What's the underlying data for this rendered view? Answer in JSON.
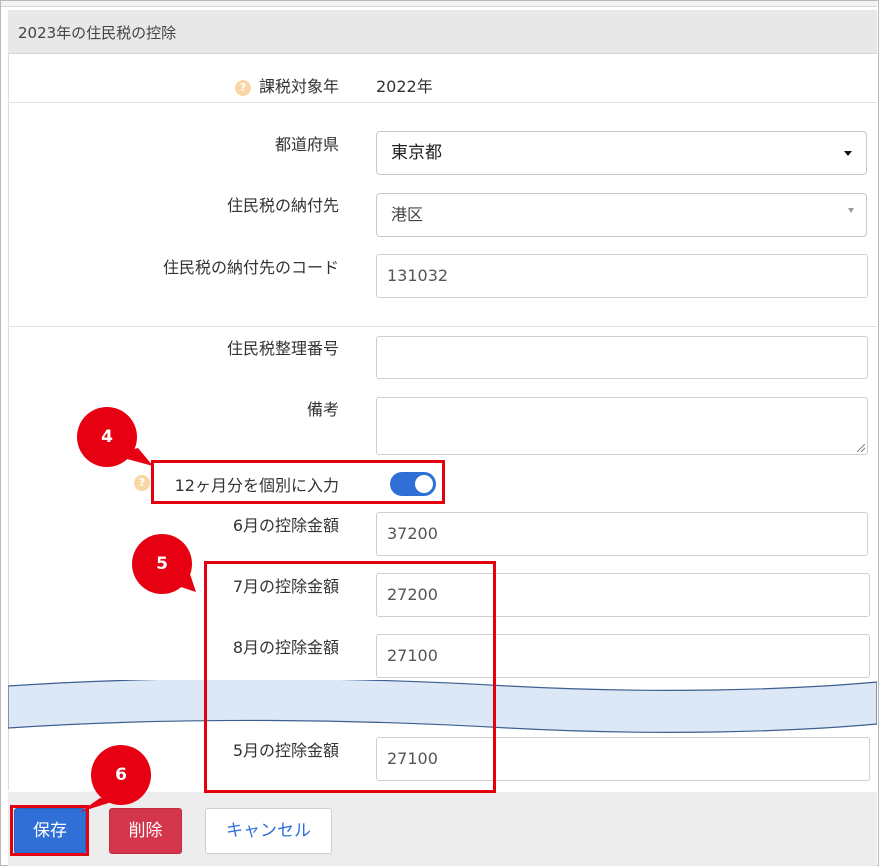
{
  "header": {
    "title": "2023年の住民税の控除"
  },
  "fields": {
    "tax_year_label": "課税対象年",
    "tax_year_value": "2022年",
    "prefecture_label": "都道府県",
    "prefecture_value": "東京都",
    "municipality_label": "住民税の納付先",
    "municipality_value": "港区",
    "municipality_code_label": "住民税の納付先のコード",
    "municipality_code_value": "131032",
    "tax_ref_number_label": "住民税整理番号",
    "tax_ref_number_value": "",
    "remarks_label": "備考",
    "remarks_value": "",
    "monthly_toggle_label": "12ヶ月分を個別に入力",
    "monthly_toggle_on": true,
    "june_label": "6月の控除金額",
    "june_value": "37200",
    "july_label": "7月の控除金額",
    "july_value": "27200",
    "august_label": "8月の控除金額",
    "august_value": "27100",
    "may_label": "5月の控除金額",
    "may_value": "27100"
  },
  "help_icon_glyph": "?",
  "callouts": {
    "c4": "4",
    "c5": "5",
    "c6": "6"
  },
  "buttons": {
    "save": "保存",
    "delete": "削除",
    "cancel": "キャンセル"
  },
  "colors": {
    "primary": "#2f6fd6",
    "danger": "#d3354a",
    "annotation_red": "#e60012",
    "wave_fill": "#dce8f6"
  }
}
